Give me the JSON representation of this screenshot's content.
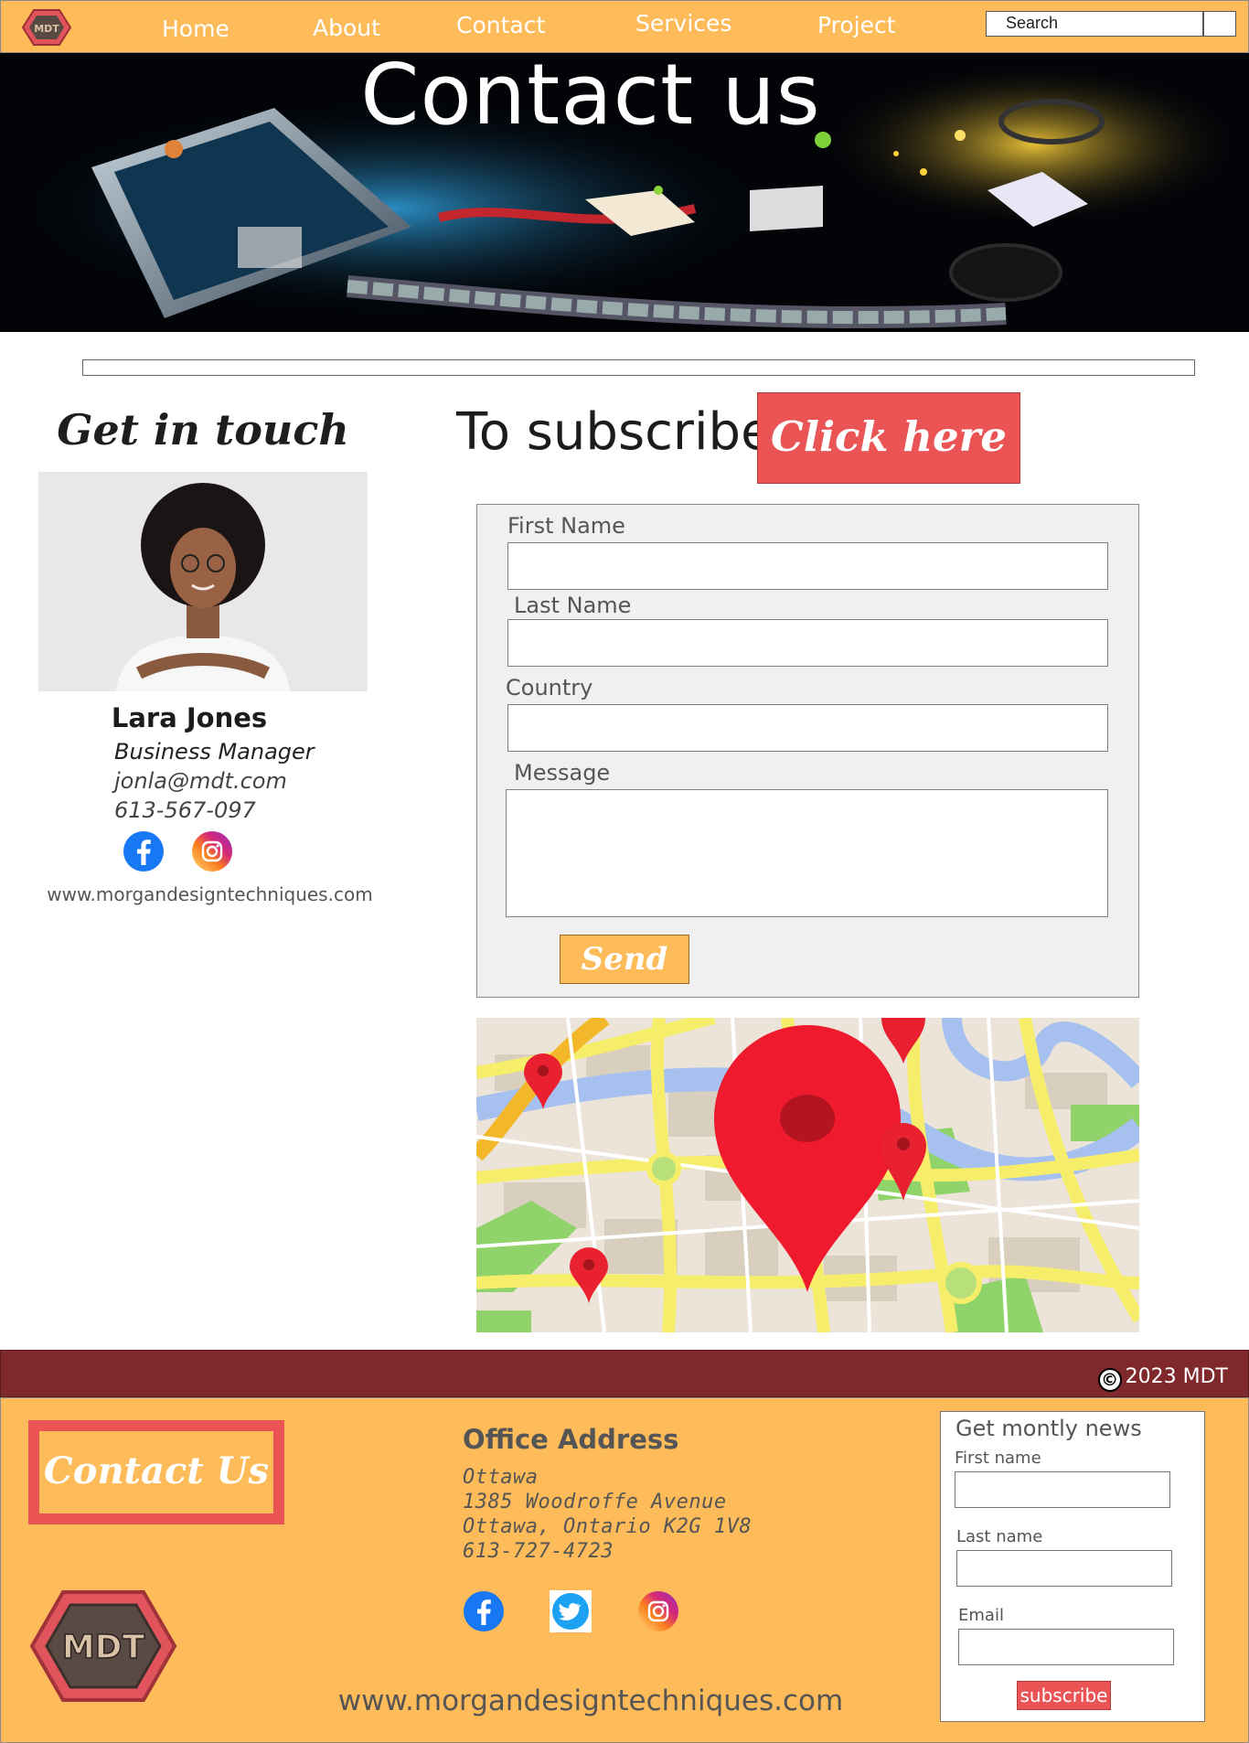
{
  "nav": {
    "logo_text": "MDT",
    "links": [
      "Home",
      "About",
      "Contact",
      "Services",
      "Project"
    ],
    "search_placeholder": "Search"
  },
  "hero": {
    "title": "Contact us"
  },
  "left": {
    "heading": "Get in touch",
    "name": "Lara Jones",
    "role": "Business Manager",
    "email": "jonla@mdt.com",
    "phone": "613-567-097",
    "site": "www.morgandesigntechniques.com",
    "social_icons": [
      "facebook-icon",
      "instagram-icon"
    ]
  },
  "subscribe": {
    "heading": "To subscribe",
    "button_label": "Click here !"
  },
  "form": {
    "first_name_label": "First Name",
    "last_name_label": "Last Name",
    "country_label": "Country",
    "message_label": "Message",
    "send_label": "Send"
  },
  "footer": {
    "copyright": "2023 MDT",
    "contact_label": "Contact Us",
    "logo_text": "MDT",
    "office_title": "Office Address",
    "office_lines": [
      "Ottawa",
      "1385 Woodroffe Avenue",
      "Ottawa, Ontario K2G 1V8",
      "613-727-4723"
    ],
    "social_icons": [
      "facebook-icon",
      "twitter-icon",
      "instagram-icon"
    ],
    "site": "www.morgandesigntechniques.com",
    "news": {
      "title": "Get montly news",
      "first_name_label": "First name",
      "last_name_label": "Last name",
      "email_label": "Email",
      "button_label": "subscribe"
    }
  },
  "colors": {
    "nav_bg": "#FEBB59",
    "accent_red": "#EA5455",
    "footer_band": "#7F292C"
  }
}
